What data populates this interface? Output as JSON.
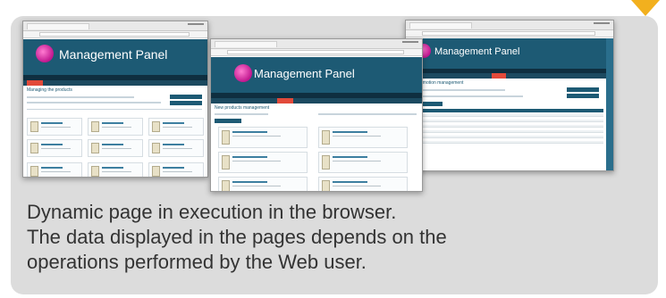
{
  "colors": {
    "panel_background": "#dcdcdc",
    "accent_marker": "#f2b01e",
    "site_header": "#1d5a74",
    "site_nav": "#0f2f40",
    "selected_tab": "#e24a3a",
    "caption_text": "#333333"
  },
  "screenshots": [
    {
      "app_title": "Management Panel",
      "page_heading": "Managing the products",
      "layout": "product-grid"
    },
    {
      "app_title": "Management Panel",
      "page_heading": "New products management",
      "layout": "product-list"
    },
    {
      "app_title": "Management Panel",
      "page_heading": "Promotion management",
      "layout": "table"
    }
  ],
  "caption": {
    "line1": "Dynamic page in execution in the browser.",
    "line2": "The data displayed in the pages depends on the",
    "line3": "operations performed by the Web user."
  }
}
